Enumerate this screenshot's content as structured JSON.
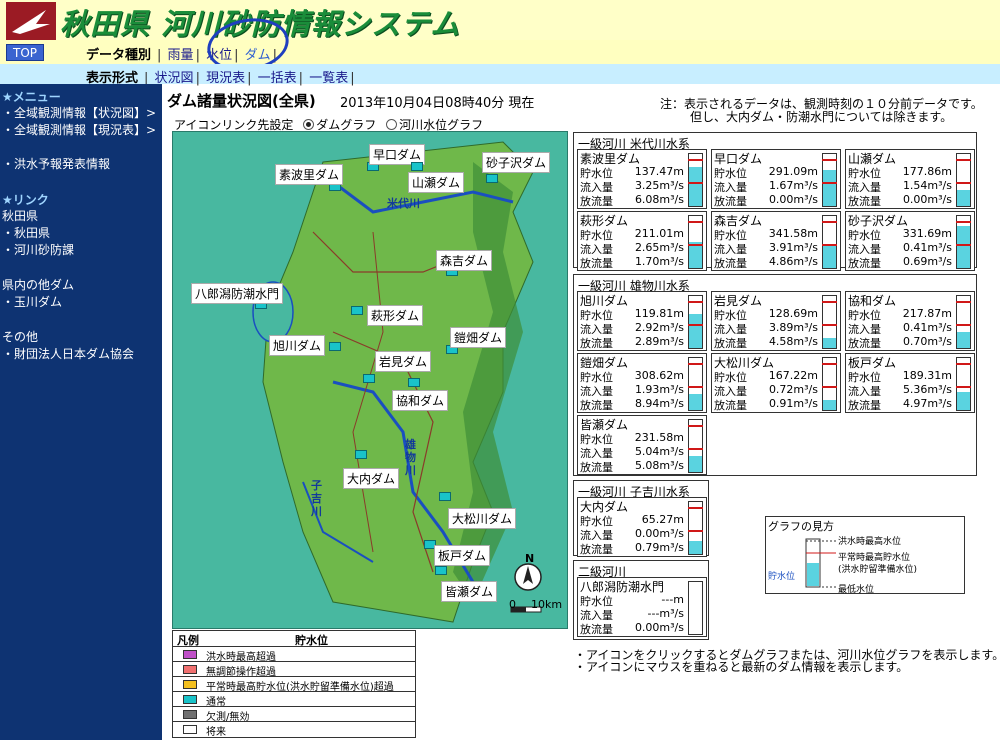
{
  "header": {
    "title": "秋田県 河川砂防情報システム"
  },
  "nav": {
    "top_label": "TOP",
    "data_type_label": "データ種別",
    "data_types": [
      "雨量",
      "水位",
      "ダム"
    ],
    "display_label": "表示形式",
    "display_types": [
      "状況図",
      "現況表",
      "一括表",
      "一覧表"
    ]
  },
  "sidebar": {
    "menu_heading": "★メニュー",
    "menu_items": [
      "・全域観測情報【状況図】>",
      "・全域観測情報【現況表】>",
      "・洪水予報発表情報"
    ],
    "link_heading": "★リンク",
    "link_items": [
      "秋田県",
      "・秋田県",
      "・河川砂防課"
    ],
    "other_dams_heading": "県内の他ダム",
    "other_dams": [
      "・玉川ダム"
    ],
    "others_heading": "その他",
    "others": [
      "・財団法人日本ダム協会"
    ]
  },
  "main": {
    "title": "ダム諸量状況図(全県)",
    "timestamp": "2013年10月04日08時40分 現在",
    "note1": "注：表示されるデータは、観測時刻の１０分前データです。",
    "note2": "但し、大内ダム・防潮水門については除きます。",
    "icon_link_label": "アイコンリンク先設定",
    "radio_dam": "ダムグラフ",
    "radio_river": "河川水位グラフ"
  },
  "map": {
    "dam_labels": [
      "早口ダム",
      "砂子沢ダム",
      "素波里ダム",
      "山瀬ダム",
      "森吉ダム",
      "八郎潟防潮水門",
      "萩形ダム",
      "鎧畑ダム",
      "旭川ダム",
      "岩見ダム",
      "協和ダム",
      "大内ダム",
      "大松川ダム",
      "板戸ダム",
      "皆瀬ダム"
    ],
    "river_labels": [
      "米代川",
      "雄物川",
      "子吉川"
    ],
    "scale_label": "10km",
    "scale_zero": "0",
    "north_label": "N"
  },
  "legend": {
    "header_left": "凡例",
    "header_right": "貯水位",
    "rows": [
      {
        "color": "#c050c8",
        "text": "洪水時最高超過"
      },
      {
        "color": "#f07070",
        "text": "無調節操作超過"
      },
      {
        "color": "#f4c020",
        "text": "平常時最高貯水位(洪水貯留準備水位)超過"
      },
      {
        "color": "#19c3c9",
        "text": "通常"
      },
      {
        "color": "#707070",
        "text": "欠測/無効"
      },
      {
        "color": "#ffffff",
        "text": "将来"
      }
    ]
  },
  "row_labels": {
    "storage": "貯水位",
    "inflow": "流入量",
    "outflow": "放流量"
  },
  "panels": [
    {
      "heading": "一級河川 米代川水系",
      "dams": [
        {
          "name": "素波里ダム",
          "storage": "137.47m",
          "inflow": "3.25m³/s",
          "outflow": "6.08m³/s",
          "level": 0.75
        },
        {
          "name": "早口ダム",
          "storage": "291.09m",
          "inflow": "1.67m³/s",
          "outflow": "0.00m³/s",
          "level": 0.7
        },
        {
          "name": "山瀬ダム",
          "storage": "177.86m",
          "inflow": "1.54m³/s",
          "outflow": "0.00m³/s",
          "level": 0.3
        },
        {
          "name": "萩形ダム",
          "storage": "211.01m",
          "inflow": "2.65m³/s",
          "outflow": "1.70m³/s",
          "level": 0.5
        },
        {
          "name": "森吉ダム",
          "storage": "341.58m",
          "inflow": "3.91m³/s",
          "outflow": "4.86m³/s",
          "level": 0.45
        },
        {
          "name": "砂子沢ダム",
          "storage": "331.69m",
          "inflow": "0.41m³/s",
          "outflow": "0.69m³/s",
          "level": 0.8
        }
      ]
    },
    {
      "heading": "一級河川 雄物川水系",
      "dams": [
        {
          "name": "旭川ダム",
          "storage": "119.81m",
          "inflow": "2.92m³/s",
          "outflow": "2.89m³/s",
          "level": 0.65
        },
        {
          "name": "岩見ダム",
          "storage": "128.69m",
          "inflow": "3.89m³/s",
          "outflow": "4.58m³/s",
          "level": 0.2
        },
        {
          "name": "協和ダム",
          "storage": "217.87m",
          "inflow": "0.41m³/s",
          "outflow": "0.70m³/s",
          "level": 0.3
        },
        {
          "name": "鎧畑ダム",
          "storage": "308.62m",
          "inflow": "1.93m³/s",
          "outflow": "8.94m³/s",
          "level": 0.3
        },
        {
          "name": "大松川ダム",
          "storage": "167.22m",
          "inflow": "0.72m³/s",
          "outflow": "0.91m³/s",
          "level": 0.2
        },
        {
          "name": "板戸ダム",
          "storage": "189.31m",
          "inflow": "5.36m³/s",
          "outflow": "4.97m³/s",
          "level": 0.35
        },
        {
          "name": "皆瀬ダム",
          "storage": "231.58m",
          "inflow": "5.04m³/s",
          "outflow": "5.08m³/s",
          "level": 0.3
        }
      ]
    },
    {
      "heading": "一級河川 子吉川水系",
      "dams": [
        {
          "name": "大内ダム",
          "storage": "65.27m",
          "inflow": "0.00m³/s",
          "outflow": "0.79m³/s",
          "level": 0.25
        }
      ]
    },
    {
      "heading": "二級河川",
      "dams": [
        {
          "name": "八郎潟防潮水門",
          "storage": "---m",
          "inflow": "---m³/s",
          "outflow": "0.00m³/s",
          "level": 0
        }
      ]
    }
  ],
  "graph_legend": {
    "title": "グラフの見方",
    "flood_max": "洪水時最高水位",
    "normal_max": "平常時最高貯水位",
    "normal_max_sub": "(洪水貯留準備水位)",
    "min": "最低水位",
    "axis": "貯水位"
  },
  "footer": {
    "line1": "・アイコンをクリックするとダムグラフまたは、河川水位グラフを表示します。",
    "line2": "・アイコンにマウスを重ねると最新のダム情報を表示します。"
  }
}
